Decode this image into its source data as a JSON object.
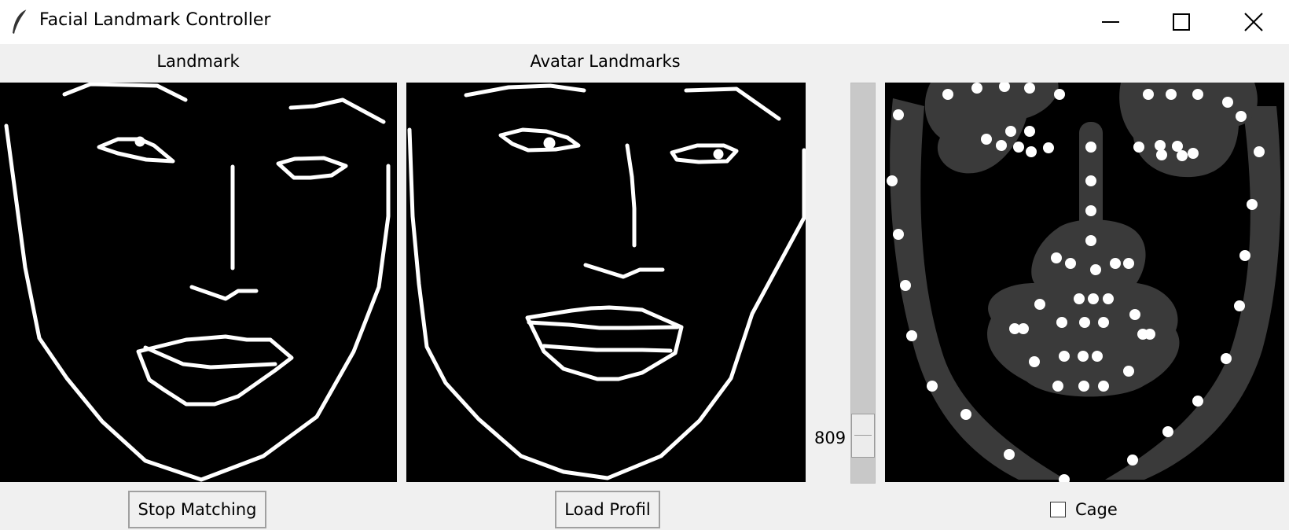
{
  "window": {
    "title": "Facial Landmark Controller",
    "controls": [
      "minimize",
      "maximize",
      "close"
    ]
  },
  "panels": {
    "left_label": "Landmark",
    "middle_label": "Avatar Landmarks"
  },
  "slider": {
    "value": "809",
    "orientation": "vertical"
  },
  "buttons": {
    "stop_matching": "Stop Matching",
    "load_profil": "Load Profil"
  },
  "checkbox": {
    "label": "Cage",
    "checked": false
  },
  "colors": {
    "window_bg": "#f0f0f0",
    "canvas_bg": "#000000",
    "landmark_line": "#ffffff",
    "blob_gray": "#3a3a3a",
    "blob_dot": "#ffffff"
  },
  "icons": {
    "app": "feather-icon",
    "minimize": "minimize-icon",
    "maximize": "maximize-icon",
    "close": "close-icon"
  }
}
